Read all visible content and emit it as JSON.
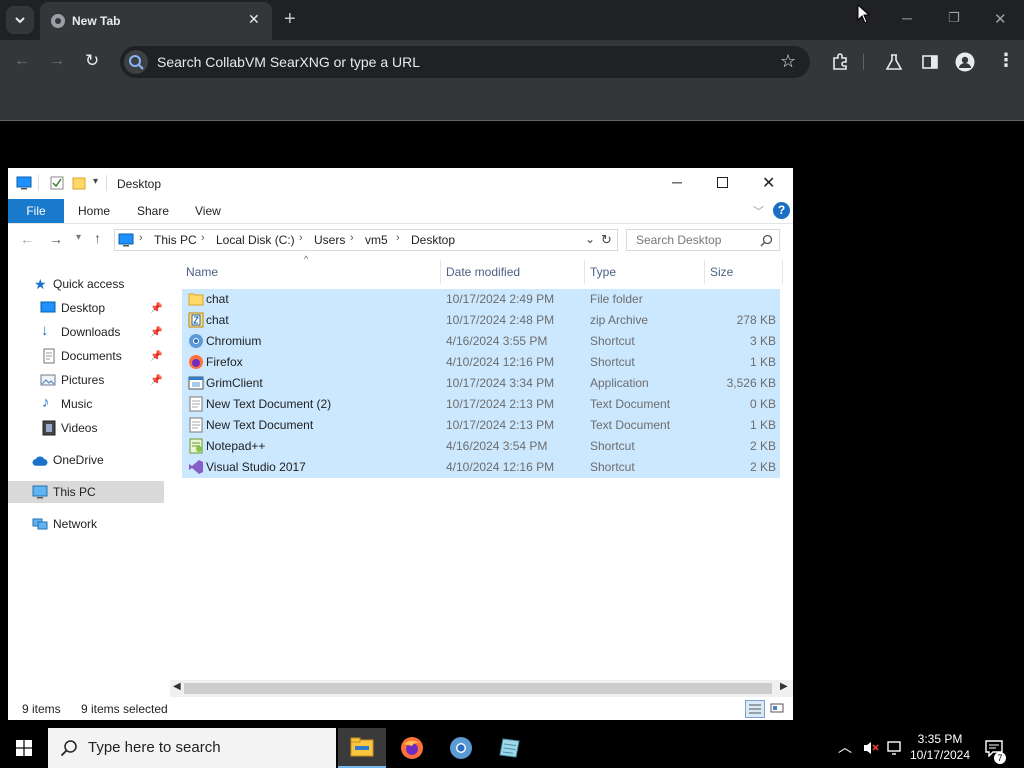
{
  "browser": {
    "tab_title": "New Tab",
    "omnibox_placeholder": "Search CollabVM SearXNG or type a URL"
  },
  "explorer": {
    "window_title": "Desktop",
    "ribbon": {
      "file": "File",
      "home": "Home",
      "share": "Share",
      "view": "View"
    },
    "breadcrumb": [
      "This PC",
      "Local Disk (C:)",
      "Users",
      "vm5",
      "Desktop"
    ],
    "search_placeholder": "Search Desktop",
    "nav": {
      "quick_access": "Quick access",
      "desktop": "Desktop",
      "downloads": "Downloads",
      "documents": "Documents",
      "pictures": "Pictures",
      "music": "Music",
      "videos": "Videos",
      "onedrive": "OneDrive",
      "this_pc": "This PC",
      "network": "Network"
    },
    "columns": {
      "name": "Name",
      "date": "Date modified",
      "type": "Type",
      "size": "Size"
    },
    "files": [
      {
        "name": "chat",
        "date": "10/17/2024 2:49 PM",
        "type": "File folder",
        "size": "",
        "icon": "folder-icon"
      },
      {
        "name": "chat",
        "date": "10/17/2024 2:48 PM",
        "type": "zip Archive",
        "size": "278 KB",
        "icon": "zip-icon"
      },
      {
        "name": "Chromium",
        "date": "4/16/2024 3:55 PM",
        "type": "Shortcut",
        "size": "3 KB",
        "icon": "chromium-icon"
      },
      {
        "name": "Firefox",
        "date": "4/10/2024 12:16 PM",
        "type": "Shortcut",
        "size": "1 KB",
        "icon": "firefox-icon"
      },
      {
        "name": "GrimClient",
        "date": "10/17/2024 3:34 PM",
        "type": "Application",
        "size": "3,526 KB",
        "icon": "application-icon"
      },
      {
        "name": "New Text Document (2)",
        "date": "10/17/2024 2:13 PM",
        "type": "Text Document",
        "size": "0 KB",
        "icon": "text-document-icon"
      },
      {
        "name": "New Text Document",
        "date": "10/17/2024 2:13 PM",
        "type": "Text Document",
        "size": "1 KB",
        "icon": "text-document-icon"
      },
      {
        "name": "Notepad++",
        "date": "4/16/2024 3:54 PM",
        "type": "Shortcut",
        "size": "2 KB",
        "icon": "notepadpp-icon"
      },
      {
        "name": "Visual Studio 2017",
        "date": "4/10/2024 12:16 PM",
        "type": "Shortcut",
        "size": "2 KB",
        "icon": "visual-studio-icon"
      }
    ],
    "status": {
      "items": "9 items",
      "selected": "9 items selected"
    }
  },
  "taskbar": {
    "search_placeholder": "Type here to search",
    "time": "3:35 PM",
    "date": "10/17/2024"
  },
  "colors": {
    "chrome_dark": "#202124",
    "chrome_toolbar": "#35363a",
    "selection": "#cce8ff",
    "file_tab": "#1979ca",
    "accent": "#0078d7"
  }
}
